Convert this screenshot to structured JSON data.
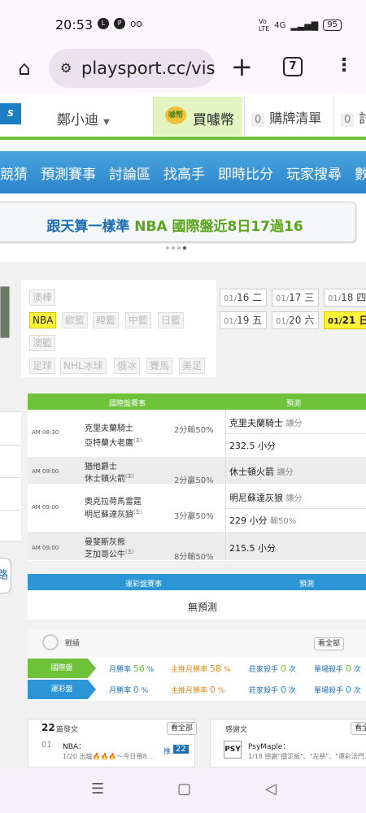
{
  "status": {
    "time": "20:53",
    "icons": [
      "line-icon",
      "p-icon",
      "voicemail-icon"
    ],
    "network": "4G",
    "battery": "95"
  },
  "browser": {
    "url": "playsport.cc/vis",
    "tab_count": "7"
  },
  "site": {
    "username": "鄭小迪",
    "buy_coins": "買噱幣",
    "coin_badge": "噱幣",
    "cart_count": "0",
    "cart_label": "購牌清單",
    "more_count": "0",
    "more_label": "討"
  },
  "nav": [
    "競猜",
    "預測賽事",
    "討論區",
    "找高手",
    "即時比分",
    "玩家搜尋",
    "數"
  ],
  "banner": {
    "prefix": "跟天算一樣準",
    "highlight": "NBA 國際盤近8日17過16"
  },
  "sports": {
    "row1": [
      "澳棒"
    ],
    "row2": [
      "NBA",
      "歐籃",
      "韓籃",
      "中籃",
      "日籃"
    ],
    "row3": [
      "澳籃"
    ],
    "row4": [
      "足球",
      "NHL冰球",
      "俄冰",
      "賽馬",
      "美足"
    ]
  },
  "dates": [
    {
      "d": "01/",
      "n": "16",
      "w": "二"
    },
    {
      "d": "01/",
      "n": "17",
      "w": "三"
    },
    {
      "d": "01/",
      "n": "18",
      "w": "四"
    },
    {
      "d": "01/",
      "n": "19",
      "w": "五"
    },
    {
      "d": "01/",
      "n": "20",
      "w": "六"
    },
    {
      "d": "01/",
      "n": "21",
      "w": "日"
    }
  ],
  "games": {
    "header_left": "國際盤賽事",
    "header_right": "預測",
    "rows": [
      {
        "time": "AM 08:30",
        "away": "克里夫蘭騎士",
        "home": "亞特蘭大老鷹",
        "home_mark": "(主)",
        "handicap": "2分輸50%",
        "pred1": "克里夫蘭騎士",
        "pred1_note": "讓分",
        "pred2": "232.5 小分",
        "pred2_note": ""
      },
      {
        "time": "AM 09:00",
        "away": "猶他爵士",
        "home": "休士頓火箭",
        "home_mark": "(主)",
        "handicap": "2分贏50%",
        "pred1": "休士頓火箭",
        "pred1_note": "讓分",
        "pred2": "",
        "pred2_note": ""
      },
      {
        "time": "AM 09:00",
        "away": "奧克拉荷馬雷霆",
        "home": "明尼蘇達灰狼",
        "home_mark": "(主)",
        "handicap": "3分贏50%",
        "pred1": "明尼蘇達灰狼",
        "pred1_note": "讓分",
        "pred2": "229 小分",
        "pred2_note": "輸50%"
      },
      {
        "time": "AM 09:00",
        "away": "曼斐斯灰熊",
        "home": "芝加哥公牛",
        "home_mark": "(主)",
        "handicap": "8分輸50%",
        "pred1": "215.5 小分",
        "pred1_note": "",
        "pred2": "",
        "pred2_note": ""
      }
    ]
  },
  "yun": {
    "header_left": "運彩盤賽事",
    "header_right": "預測",
    "empty": "無預測"
  },
  "record": {
    "title": "戰績",
    "see_all": "看全部",
    "rows": [
      {
        "tag": "國際盤",
        "rate_label": "月勝率",
        "rate": "56",
        "rate_unit": "%",
        "main_label": "主推月勝率",
        "main": "58",
        "main_unit": "%",
        "killer_label": "莊家殺手",
        "killer": "0",
        "killer_unit": "次",
        "single_label": "單場殺手",
        "single": "0",
        "single_unit": "次"
      },
      {
        "tag": "運彩盤",
        "rate_label": "月勝率",
        "rate": "0",
        "rate_unit": "%",
        "main_label": "主推月勝率",
        "main": "0",
        "main_unit": "%",
        "killer_label": "莊家殺手",
        "killer": "0",
        "killer_unit": "次",
        "single_label": "單場殺手",
        "single": "0",
        "single_unit": "次"
      }
    ],
    "colors": {
      "intl": "#6dc23a",
      "yun": "#2b95d6"
    }
  },
  "posts": {
    "count": "22",
    "label": "篇發文",
    "see_all": "看全部",
    "no": "01",
    "title": "NBA：",
    "sub": "1/20 出爐🔥🔥🔥～今日預8...",
    "tag": "推",
    "push": "22"
  },
  "feeling": {
    "label": "感謝文",
    "see_all": "看全",
    "avatar": "PSY",
    "title": "PsyMaple：",
    "sub": "1/18 感謝\"擂泥板\"、\"左慈\"、\"運彩法門..."
  }
}
